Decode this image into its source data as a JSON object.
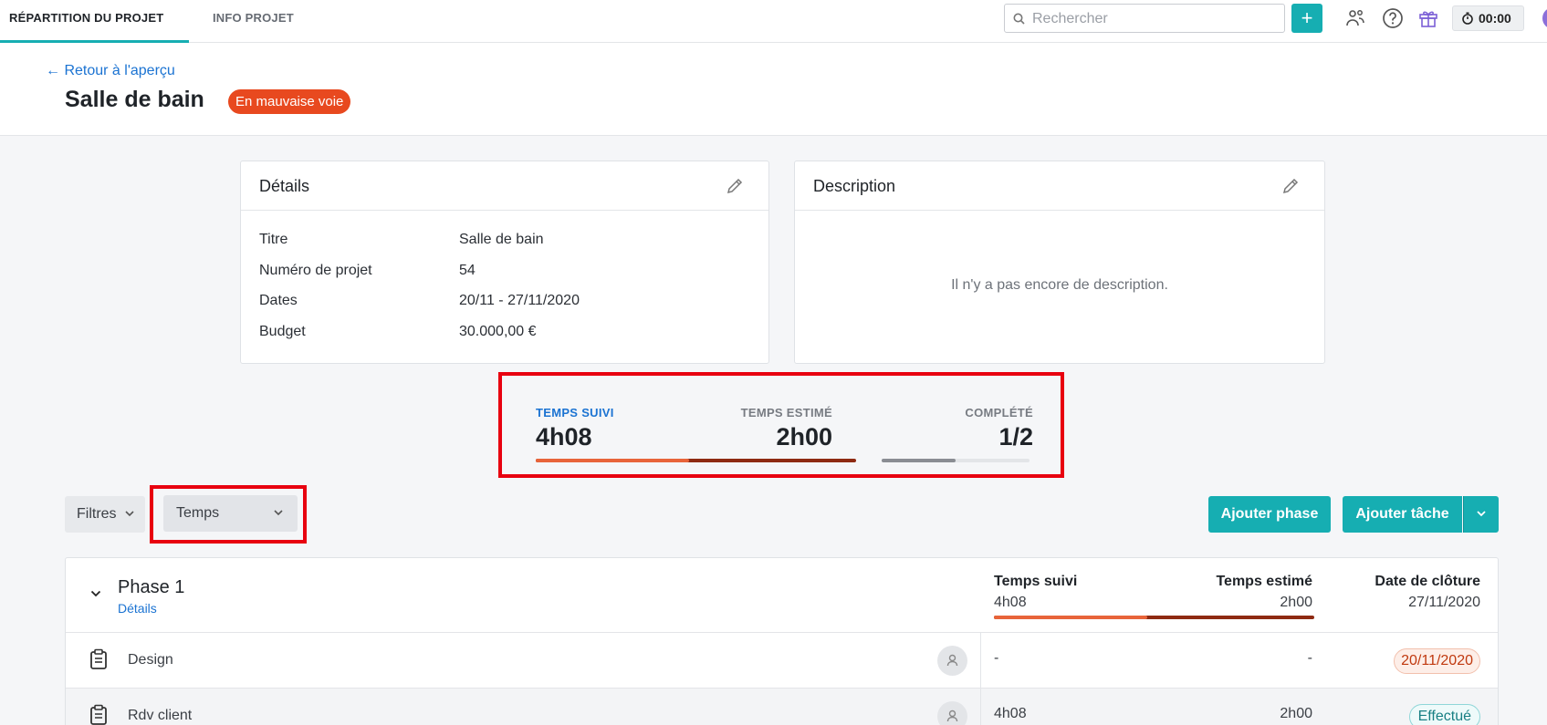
{
  "nav": {
    "tab_active": "RÉPARTITION DU PROJET",
    "tab_info": "INFO PROJET",
    "search_placeholder": "Rechercher",
    "add_label": "+",
    "timer": "00:00"
  },
  "header": {
    "back_label": "Retour à l'aperçu",
    "title": "Salle de bain",
    "status": "En mauvaise voie"
  },
  "details": {
    "title": "Détails",
    "rows": [
      {
        "label": "Titre",
        "value": "Salle de bain"
      },
      {
        "label": "Numéro de projet",
        "value": "54"
      },
      {
        "label": "Dates",
        "value": "20/11 - 27/11/2020"
      },
      {
        "label": "Budget",
        "value": "30.000,00 €"
      }
    ]
  },
  "description": {
    "title": "Description",
    "empty_text": "Il n'y a pas encore de description."
  },
  "stats": {
    "tracked_label": "TEMPS SUIVI",
    "tracked_value": "4h08",
    "estimated_label": "TEMPS ESTIMÉ",
    "estimated_value": "2h00",
    "completed_label": "COMPLÉTÉ",
    "completed_value": "1/2",
    "time_bar_estimate_fraction": 0.48,
    "completed_fraction": 0.5
  },
  "toolbar": {
    "filters_label": "Filtres",
    "group_select_value": "Temps",
    "add_phase_label": "Ajouter phase",
    "add_task_label": "Ajouter tâche"
  },
  "phase": {
    "name": "Phase 1",
    "details_link": "Détails",
    "col_tracked": "Temps suivi",
    "col_estimated": "Temps estimé",
    "col_close": "Date de clôture",
    "tracked": "4h08",
    "estimated": "2h00",
    "close_date": "27/11/2020",
    "tasks": [
      {
        "name": "Design",
        "tracked": "-",
        "estimated": "-",
        "status": "20/11/2020"
      },
      {
        "name": "Rdv client",
        "tracked": "4h08",
        "estimated": "2h00",
        "status": "Effectué"
      }
    ]
  },
  "colors": {
    "accent": "#16aeb2",
    "danger_badge": "#e8491f",
    "link": "#1b73d2",
    "bar_tracked": "#e8643a",
    "bar_over": "#8e2a12",
    "highlight": "#e8000f"
  }
}
